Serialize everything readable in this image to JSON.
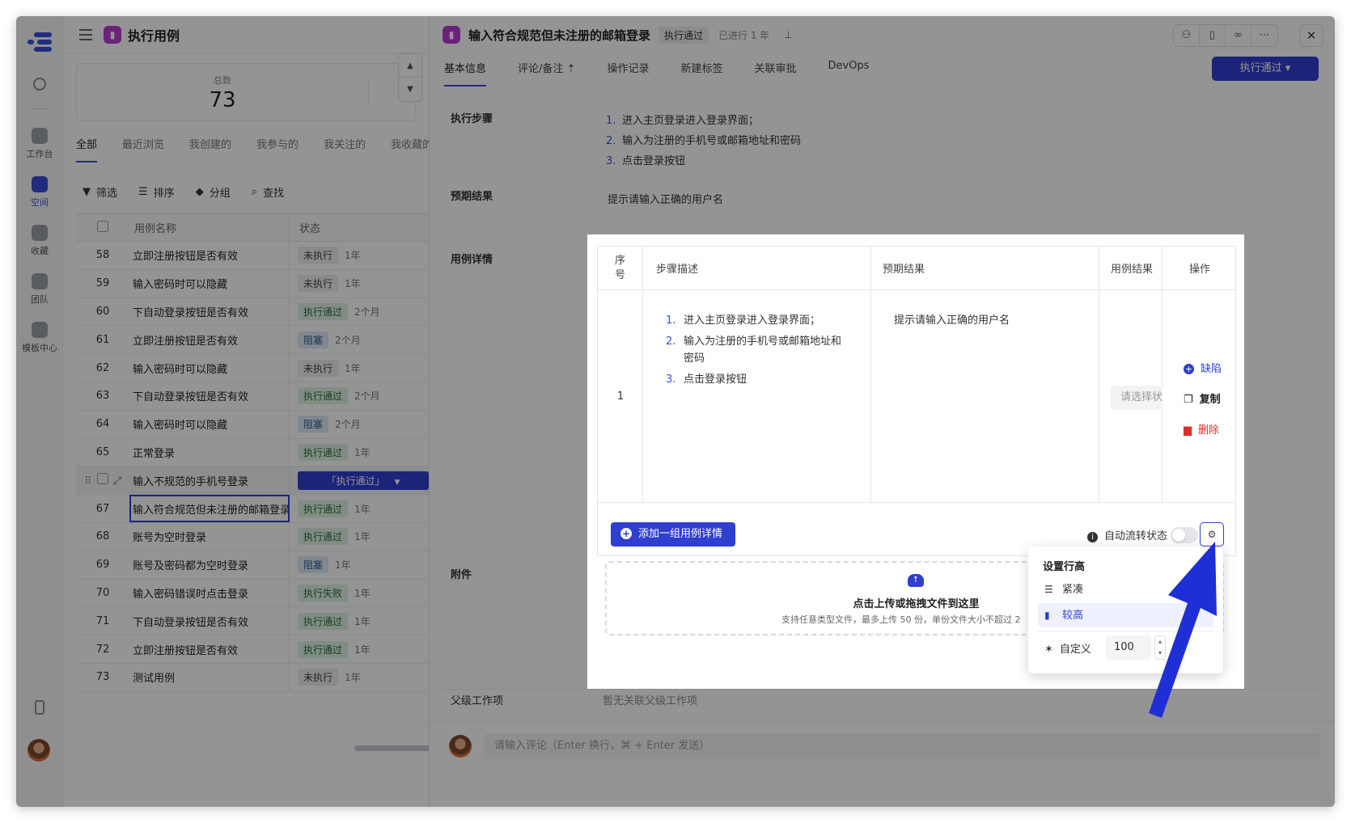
{
  "list": {
    "title": "执行用例",
    "stats_label": "总数",
    "stats_value": "73",
    "tabs": [
      "全部",
      "最近浏览",
      "我创建的",
      "我参与的",
      "我关注的",
      "我收藏的"
    ],
    "toolbar": [
      "筛选",
      "排序",
      "分组",
      "查找"
    ],
    "columns": [
      "用例名称",
      "状态"
    ],
    "rows": [
      {
        "idx": "58",
        "name": "立即注册按钮是否有效",
        "status": "未执行",
        "kind": "notrun",
        "time": "1年"
      },
      {
        "idx": "59",
        "name": "输入密码时可以隐藏",
        "status": "未执行",
        "kind": "notrun",
        "time": "1年"
      },
      {
        "idx": "60",
        "name": "下自动登录按钮是否有效",
        "status": "执行通过",
        "kind": "pass",
        "time": "2个月"
      },
      {
        "idx": "61",
        "name": "立即注册按钮是否有效",
        "status": "阻塞",
        "kind": "block",
        "time": "2个月"
      },
      {
        "idx": "62",
        "name": "输入密码时可以隐藏",
        "status": "未执行",
        "kind": "notrun",
        "time": "1年"
      },
      {
        "idx": "63",
        "name": "下自动登录按钮是否有效",
        "status": "执行通过",
        "kind": "pass",
        "time": "2个月"
      },
      {
        "idx": "64",
        "name": "输入密码时可以隐藏",
        "status": "阻塞",
        "kind": "block",
        "time": "2个月"
      },
      {
        "idx": "65",
        "name": "正常登录",
        "status": "执行通过",
        "kind": "pass",
        "time": "1年"
      },
      {
        "idx": "",
        "name": "输入不规范的手机号登录",
        "status": "「执行通过」",
        "kind": "dropdown",
        "time": ""
      },
      {
        "idx": "67",
        "name": "输入符合规范但未注册的邮箱登录",
        "status": "执行通过",
        "kind": "pass",
        "time": "1年"
      },
      {
        "idx": "68",
        "name": "账号为空时登录",
        "status": "执行通过",
        "kind": "pass",
        "time": "1年"
      },
      {
        "idx": "69",
        "name": "账号及密码都为空时登录",
        "status": "阻塞",
        "kind": "block",
        "time": "1年"
      },
      {
        "idx": "70",
        "name": "输入密码错误时点击登录",
        "status": "执行失败",
        "kind": "fail",
        "time": "1年"
      },
      {
        "idx": "71",
        "name": "下自动登录按钮是否有效",
        "status": "执行通过",
        "kind": "pass",
        "time": "1年"
      },
      {
        "idx": "72",
        "name": "立即注册按钮是否有效",
        "status": "执行通过",
        "kind": "pass",
        "time": "1年"
      },
      {
        "idx": "73",
        "name": "测试用例",
        "status": "未执行",
        "kind": "notrun",
        "time": "1年"
      }
    ]
  },
  "rail": [
    {
      "label": "工作台"
    },
    {
      "label": "空间"
    },
    {
      "label": "收藏"
    },
    {
      "label": "团队"
    },
    {
      "label": "模板中心"
    }
  ],
  "detail": {
    "title": "输入符合规范但未注册的邮箱登录",
    "status_badge": "执行通过",
    "meta": "已进行 1 年",
    "tabs": [
      "基本信息",
      "评论/备注",
      "操作记录",
      "新建标签",
      "关联审批",
      "DevOps"
    ],
    "run_button": "执行通过 ▾",
    "labels": {
      "steps": "执行步骤",
      "expected": "预期结果",
      "case_detail": "用例详情",
      "attachment": "附件",
      "parent": "父级工作项"
    },
    "steps": [
      "进入主页登录进入登录界面；",
      "输入为注册的手机号或邮箱地址和密码",
      "点击登录按钮"
    ],
    "expected": "提示请输入正确的用户名",
    "parent_value": "暂无关联父级工作项",
    "comment_placeholder": "请输入评论（Enter 换行，⌘ + Enter 发送）"
  },
  "modal": {
    "headers": {
      "no": "序号",
      "desc": "步骤描述",
      "expected": "预期结果",
      "result": "用例结果",
      "ops": "操作"
    },
    "row_no": "1",
    "steps": [
      "进入主页登录进入登录界面；",
      "输入为注册的手机号或邮箱地址和",
      "密码",
      "点击登录按钮"
    ],
    "step_nums": [
      "1.",
      "2.",
      "",
      "3."
    ],
    "expected": "提示请输入正确的用户名",
    "result_placeholder": "请选择状态",
    "ops": {
      "defect": "缺陷",
      "copy": "复制",
      "delete": "删除"
    },
    "add_button": "添加一组用例详情",
    "auto_flow": "自动流转状态",
    "upload_title": "点击上传或拖拽文件到这里",
    "upload_hint": "支持任意类型文件，最多上传 50 份，单份文件大小不超过 2"
  },
  "row_height_popup": {
    "title": "设置行高",
    "options": [
      "紧凑",
      "较高"
    ],
    "custom_label": "自定义",
    "custom_value": "100"
  },
  "colors": {
    "accent": "#2f3fd0",
    "arrow": "#1e2fd6"
  }
}
